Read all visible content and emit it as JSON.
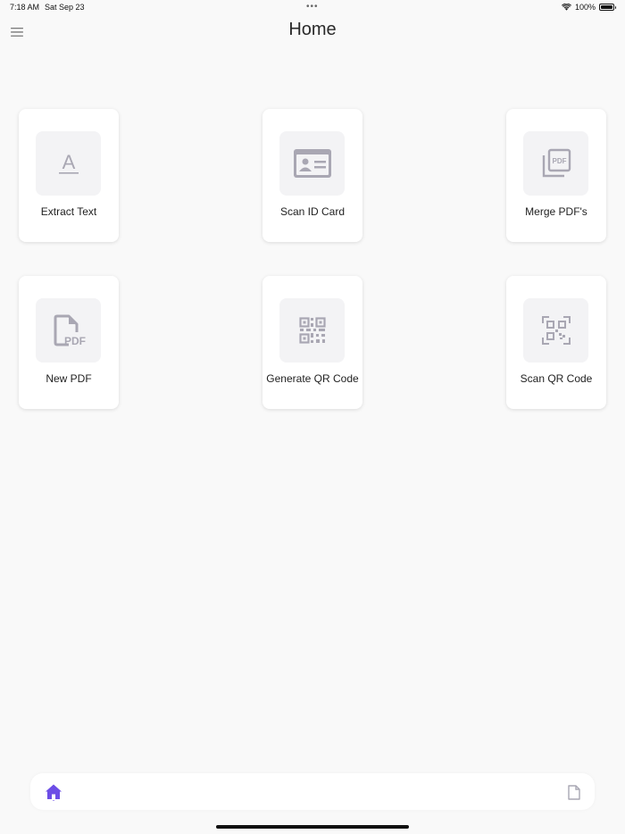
{
  "status_bar": {
    "time": "7:18 AM",
    "date": "Sat Sep 23",
    "dots": "•••",
    "battery": "100%",
    "icons": [
      "wifi-icon",
      "battery-icon"
    ]
  },
  "header": {
    "title": "Home",
    "menu_icon": "hamburger-menu-icon"
  },
  "tools": [
    {
      "label": "Extract Text",
      "icon": "text-extract-icon"
    },
    {
      "label": "Scan ID Card",
      "icon": "id-card-icon"
    },
    {
      "label": "Merge PDF's",
      "icon": "merge-pdf-icon"
    },
    {
      "label": "New PDF",
      "icon": "new-pdf-icon"
    },
    {
      "label": "Generate QR Code",
      "icon": "qr-code-icon"
    },
    {
      "label": "Scan QR Code",
      "icon": "qr-scan-icon"
    }
  ],
  "icon_glyphs": {
    "extract_text": "A",
    "pdf": "PDF"
  },
  "bottom_nav": {
    "items": [
      "home-icon",
      "document-icon"
    ]
  },
  "colors": {
    "accent": "#6c4de6",
    "icon_gray": "#a9a7b3",
    "icon_box": "#f3f3f5",
    "background": "#f9f9f9"
  }
}
